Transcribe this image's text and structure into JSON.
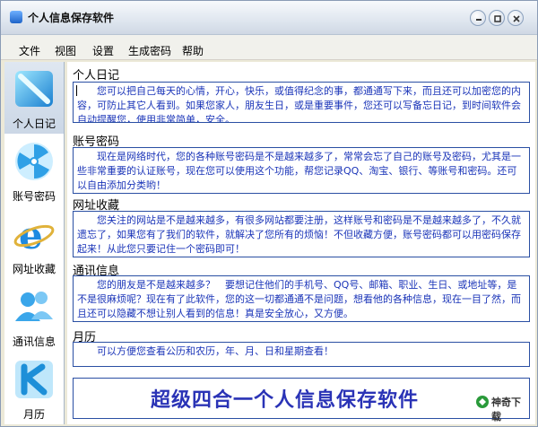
{
  "window": {
    "title": "个人信息保存软件"
  },
  "menu": [
    "文件",
    "视图",
    "设置",
    "生成密码",
    "帮助"
  ],
  "sidebar": {
    "items": [
      {
        "label": "个人日记",
        "icon": "diary-icon"
      },
      {
        "label": "账号密码",
        "icon": "radiation-icon"
      },
      {
        "label": "网址收藏",
        "icon": "ie-browser-icon"
      },
      {
        "label": "通讯信息",
        "icon": "contacts-icon"
      },
      {
        "label": "月历",
        "icon": "calendar-icon"
      }
    ]
  },
  "sections": [
    {
      "title": "个人日记",
      "text": "　　您可以把自己每天的心情，开心，快乐，或值得纪念的事，都通通写下来，而且还可以加密您的内容，可防止其它人看到。如果您家人，朋友生日，或是重要事件，您还可以写备忘日记，到时间软件会自动提醒您，使用非常简单，安全。"
    },
    {
      "title": "账号密码",
      "text": "　　现在是网络时代，您的各种账号密码是不是越来越多了，常常会忘了自己的账号及密码，尤其是一些非常重要的认证账号，现在您可以使用这个功能，帮您记录QQ、淘宝、银行、等账号和密码。还可以自由添加分类哟！"
    },
    {
      "title": "网址收藏",
      "text": "　　您关注的网站是不是越来越多，有很多网站都要注册，这样账号和密码是不是越来越多了，不久就遗忘了，如果您有了我们的软件，就解决了您所有的烦恼！不但收藏方便，账号密码都可以用密码保存起来！从此您只要记住一个密码即可！"
    },
    {
      "title": "通讯信息",
      "text": "　　您的朋友是不是越来越多？　要想记住他们的手机号、QQ号、邮箱、职业、生日、或地址等，是不是很麻烦呢？现在有了此软件，您的这一切都通通不是问题，想看他的各种信息，现在一目了然，而且还可以隐藏不想让别人看到的信息！真是安全放心，又方便。"
    },
    {
      "title": "月历",
      "text": "　　可以方便您查看公历和农历，年、月、日和星期查看！"
    }
  ],
  "banner": {
    "text": "超级四合一个人信息保存软件"
  },
  "watermark": {
    "text": "神奇下载"
  },
  "colors": {
    "accent": "#2a33b6",
    "box_border": "#2a4fa3",
    "body_text": "#1a34b8"
  }
}
